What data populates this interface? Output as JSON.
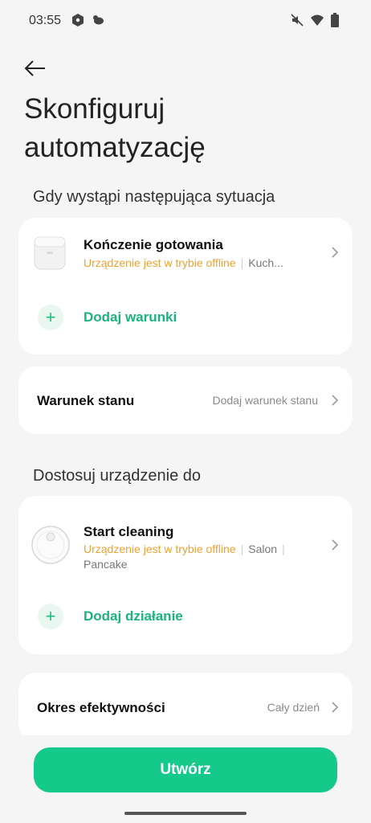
{
  "status_bar": {
    "time": "03:55"
  },
  "header": {
    "back_icon": "arrow-left-icon",
    "title": "Skonfiguruj automatyzację"
  },
  "condition_section": {
    "label": "Gdy wystąpi następująca sytuacja",
    "device": {
      "name": "Kończenie gotowania",
      "status": "Urządzenie jest w trybie offline",
      "room": "Kuch..."
    },
    "add_label": "Dodaj warunki"
  },
  "state_condition": {
    "label": "Warunek stanu",
    "value": "Dodaj warunek stanu"
  },
  "action_section": {
    "label": "Dostosuj urządzenie do",
    "device": {
      "name": "Start cleaning",
      "status": "Urządzenie jest w trybie offline",
      "room": "Salon",
      "extra": "Pancake"
    },
    "add_label": "Dodaj działanie"
  },
  "effective_period": {
    "label": "Okres efektywności",
    "value": "Cały dzień"
  },
  "create_button": {
    "label": "Utwórz"
  },
  "colors": {
    "accent": "#14c98a",
    "offline": "#f0a22e",
    "background": "#f5f5f5"
  }
}
